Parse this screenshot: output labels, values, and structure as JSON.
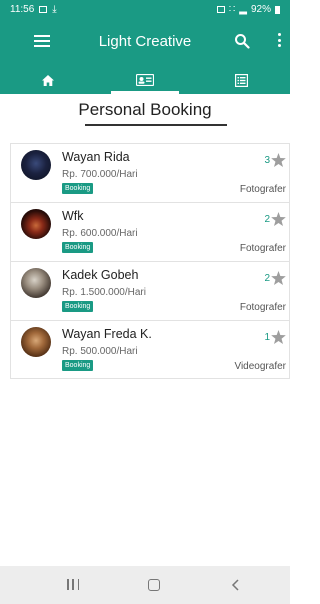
{
  "status_bar": {
    "time": "11:56",
    "battery": "92%"
  },
  "app_bar": {
    "title": "Light Creative",
    "icons": [
      "menu-icon",
      "search-icon",
      "more-vert-icon"
    ]
  },
  "tabs": [
    {
      "icon": "home-icon",
      "active": false
    },
    {
      "icon": "id-card-icon",
      "active": true
    },
    {
      "icon": "list-icon",
      "active": false
    }
  ],
  "page": {
    "title": "Personal Booking"
  },
  "bookings": [
    {
      "name": "Wayan Rida",
      "price": "Rp. 700.000/Hari",
      "badge": "Booking",
      "rating": "3",
      "role": "Fotografer"
    },
    {
      "name": "Wfk",
      "price": "Rp. 600.000/Hari",
      "badge": "Booking",
      "rating": "2",
      "role": "Fotografer"
    },
    {
      "name": "Kadek Gobeh",
      "price": "Rp. 1.500.000/Hari",
      "badge": "Booking",
      "rating": "2",
      "role": "Fotografer"
    },
    {
      "name": "Wayan Freda K.",
      "price": "Rp. 500.000/Hari",
      "badge": "Booking",
      "rating": "1",
      "role": "Videografer"
    }
  ],
  "colors": {
    "primary": "#1a9a84",
    "star": "#9e9e9e"
  }
}
